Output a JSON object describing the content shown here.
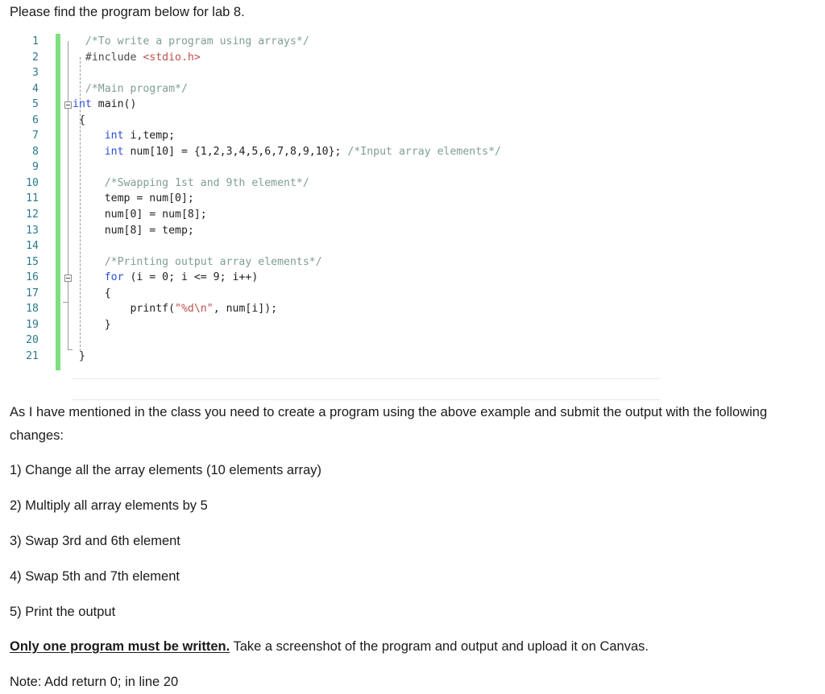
{
  "document": {
    "intro": "Please find the program below for lab 8.",
    "body_paragraph": "As I have mentioned in the class you need to create a program using the above example and submit the output with the following changes:",
    "list_items": [
      "1) Change all the array elements (10 elements array)",
      "2) Multiply all array elements by 5",
      "3) Swap 3rd and 6th element",
      "4) Swap 5th and 7th element",
      "5) Print the output"
    ],
    "final_note_bold": "Only one program must be written.",
    "final_note_rest": " Take a screenshot of the program and output and upload it on Canvas.",
    "note_line": "Note: Add return 0; in line  20"
  },
  "code_block": {
    "language": "C",
    "line_numbers": [
      "1",
      "2",
      "3",
      "4",
      "5",
      "6",
      "7",
      "8",
      "9",
      "10",
      "11",
      "12",
      "13",
      "14",
      "15",
      "16",
      "17",
      "18",
      "19",
      "20",
      "21"
    ],
    "colors": {
      "comment": "#7f9e92",
      "keyword": "#2b4fd8",
      "string": "#c0504d",
      "plain": "#1f1f1f",
      "preprocessor": "#4a4a4a",
      "line_number": "#2b7a8c",
      "change_bar": "#7ee07e",
      "guide": "#9b9b9b",
      "rule": "#e7e8ee"
    },
    "lines": [
      {
        "n": "1",
        "tokens": [
          {
            "t": "  /*To write a program using arrays*/",
            "c": "comment"
          }
        ]
      },
      {
        "n": "2",
        "tokens": [
          {
            "t": "  #include ",
            "c": "preprocessor"
          },
          {
            "t": "<stdio.h>",
            "c": "string"
          }
        ]
      },
      {
        "n": "3",
        "tokens": [
          {
            "t": "",
            "c": "plain"
          }
        ]
      },
      {
        "n": "4",
        "tokens": [
          {
            "t": "  /*Main program*/",
            "c": "comment"
          }
        ]
      },
      {
        "n": "5",
        "tokens": [
          {
            "t": "int",
            "c": "keyword"
          },
          {
            "t": " main()",
            "c": "plain"
          }
        ]
      },
      {
        "n": "6",
        "tokens": [
          {
            "t": " {",
            "c": "plain"
          }
        ]
      },
      {
        "n": "7",
        "tokens": [
          {
            "t": "     ",
            "c": "plain"
          },
          {
            "t": "int",
            "c": "keyword"
          },
          {
            "t": " i,temp;",
            "c": "plain"
          }
        ]
      },
      {
        "n": "8",
        "tokens": [
          {
            "t": "     ",
            "c": "plain"
          },
          {
            "t": "int",
            "c": "keyword"
          },
          {
            "t": " num[10] = {1,2,3,4,5,6,7,8,9,10}; ",
            "c": "plain"
          },
          {
            "t": "/*Input array elements*/",
            "c": "comment"
          }
        ]
      },
      {
        "n": "9",
        "tokens": [
          {
            "t": "",
            "c": "plain"
          }
        ]
      },
      {
        "n": "10",
        "tokens": [
          {
            "t": "     ",
            "c": "plain"
          },
          {
            "t": "/*Swapping 1st and 9th element*/",
            "c": "comment"
          }
        ]
      },
      {
        "n": "11",
        "tokens": [
          {
            "t": "     temp = num[0];",
            "c": "plain"
          }
        ]
      },
      {
        "n": "12",
        "tokens": [
          {
            "t": "     num[0] = num[8];",
            "c": "plain"
          }
        ]
      },
      {
        "n": "13",
        "tokens": [
          {
            "t": "     num[8] = temp;",
            "c": "plain"
          }
        ]
      },
      {
        "n": "14",
        "tokens": [
          {
            "t": "",
            "c": "plain"
          }
        ]
      },
      {
        "n": "15",
        "tokens": [
          {
            "t": "     ",
            "c": "plain"
          },
          {
            "t": "/*Printing output array elements*/",
            "c": "comment"
          }
        ]
      },
      {
        "n": "16",
        "tokens": [
          {
            "t": "     ",
            "c": "plain"
          },
          {
            "t": "for",
            "c": "keyword"
          },
          {
            "t": " (i = 0; i <= 9; i++)",
            "c": "plain"
          }
        ]
      },
      {
        "n": "17",
        "tokens": [
          {
            "t": "     {",
            "c": "plain"
          }
        ]
      },
      {
        "n": "18",
        "tokens": [
          {
            "t": "         printf(",
            "c": "plain"
          },
          {
            "t": "\"%d\\n\"",
            "c": "string"
          },
          {
            "t": ", num[i]);",
            "c": "plain"
          }
        ]
      },
      {
        "n": "19",
        "tokens": [
          {
            "t": "     }",
            "c": "plain"
          }
        ]
      },
      {
        "n": "20",
        "tokens": [
          {
            "t": "",
            "c": "plain"
          }
        ]
      },
      {
        "n": "21",
        "tokens": [
          {
            "t": " }",
            "c": "plain"
          }
        ]
      }
    ]
  }
}
